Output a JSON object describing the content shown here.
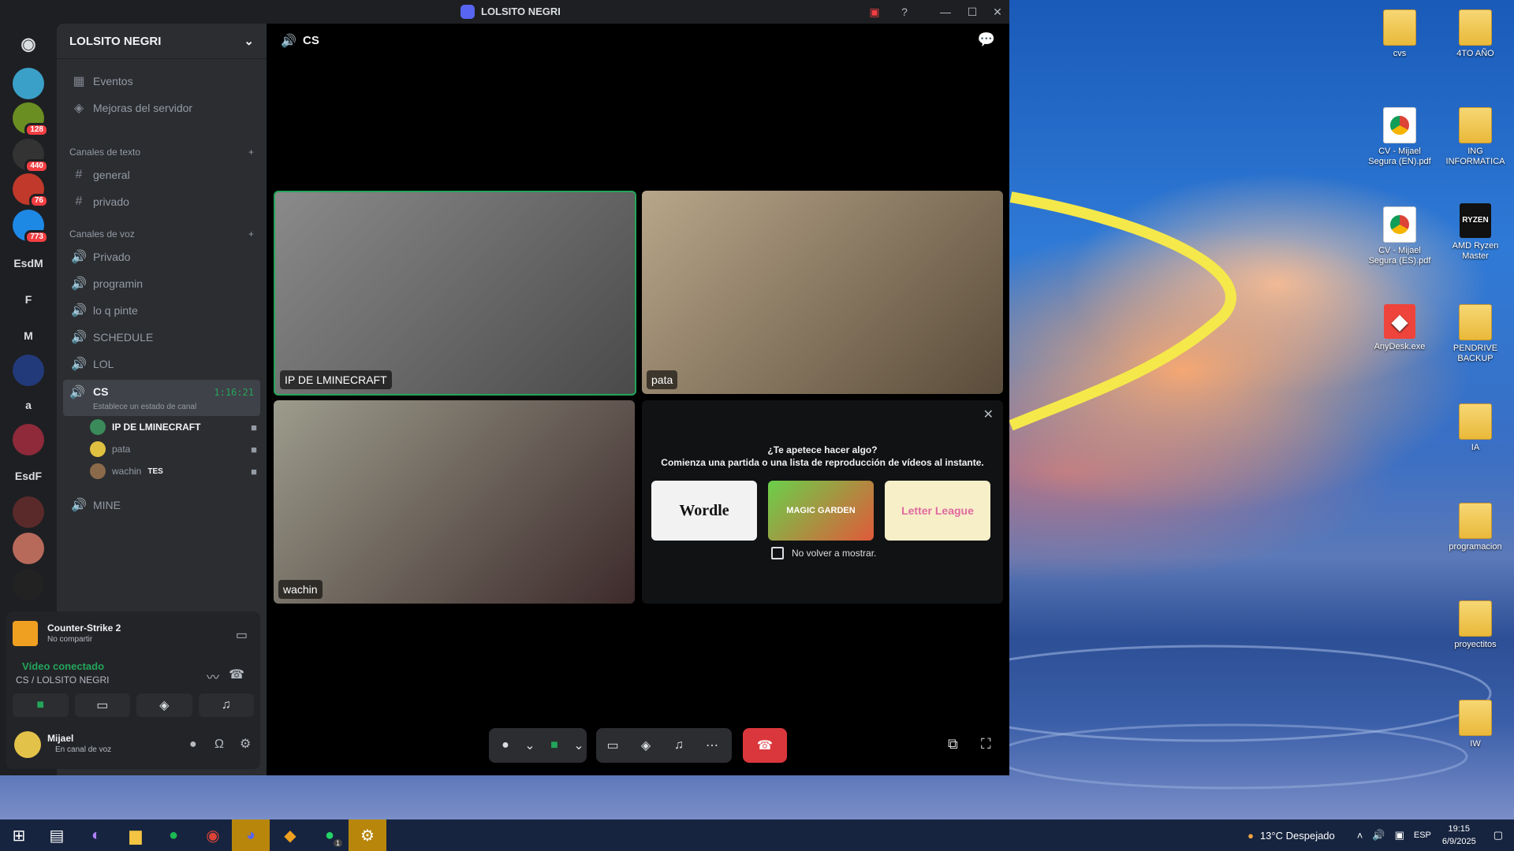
{
  "window": {
    "title": "LOLSITO NEGRI"
  },
  "guilds": [
    {
      "badge": ""
    },
    {
      "badge": "128"
    },
    {
      "badge": "440"
    },
    {
      "badge": "76"
    },
    {
      "badge": "773"
    },
    {
      "label": "EsdM"
    },
    {
      "label": "F"
    },
    {
      "label": "M"
    },
    {
      "label": ""
    },
    {
      "label": "a"
    },
    {
      "label": ""
    },
    {
      "label": "EsdF"
    }
  ],
  "sidebar": {
    "server_name": "LOLSITO NEGRI",
    "events": "Eventos",
    "boosts": "Mejoras del servidor",
    "text_category": "Canales de texto",
    "text_channels": [
      "general",
      "privado"
    ],
    "voice_category": "Canales de voz",
    "voice_channels": [
      "Privado",
      "programin",
      "lo q pinte",
      "SCHEDULE",
      "LOL"
    ],
    "active_channel": {
      "name": "CS",
      "timer": "1:16:21",
      "status": "Establece un estado de canal"
    },
    "members": [
      {
        "name": "IP DE LMINECRAFT"
      },
      {
        "name": "pata"
      },
      {
        "name": "wachin",
        "tag": "TES"
      }
    ],
    "last_channel": "MINE"
  },
  "activity": {
    "game": "Counter-Strike 2",
    "share": "No compartir"
  },
  "connection": {
    "status": "Vídeo conectado",
    "channel": "CS / LOLSITO NEGRI"
  },
  "user": {
    "name": "Mijael",
    "status": "En canal de voz"
  },
  "main": {
    "channel": "CS",
    "tiles": [
      {
        "name": "IP DE LMINECRAFT"
      },
      {
        "name": "pata"
      },
      {
        "name": "wachin"
      }
    ],
    "activity_prompt": {
      "title": "¿Te apetece hacer algo?",
      "subtitle": "Comienza una partida o una lista de reproducción de vídeos al instante.",
      "games": [
        "Wordle",
        "MAGIC GARDEN",
        "Letter League"
      ],
      "checkbox": "No volver a mostrar."
    }
  },
  "desktop_icons": [
    {
      "label": "cvs",
      "type": "folder"
    },
    {
      "label": "4TO AÑO",
      "type": "folder"
    },
    {
      "label": "CV - Mijael Segura (EN).pdf",
      "type": "pdf"
    },
    {
      "label": "ING INFORMATICA",
      "type": "folder"
    },
    {
      "label": "CV - Mijael Segura (ES).pdf",
      "type": "pdf"
    },
    {
      "label": "AMD Ryzen Master",
      "type": "ryzen"
    },
    {
      "label": "AnyDesk.exe",
      "type": "anydesk"
    },
    {
      "label": "PENDRIVE BACKUP",
      "type": "folder"
    },
    {
      "label": "IA",
      "type": "folder"
    },
    {
      "label": "programacion",
      "type": "folder"
    },
    {
      "label": "proyectitos",
      "type": "folder"
    },
    {
      "label": "IW",
      "type": "folder"
    }
  ],
  "taskbar": {
    "weather": "13°C  Despejado",
    "lang": "ESP",
    "time": "19:15",
    "date": "6/9/2025",
    "whatsapp_badge": "1"
  }
}
